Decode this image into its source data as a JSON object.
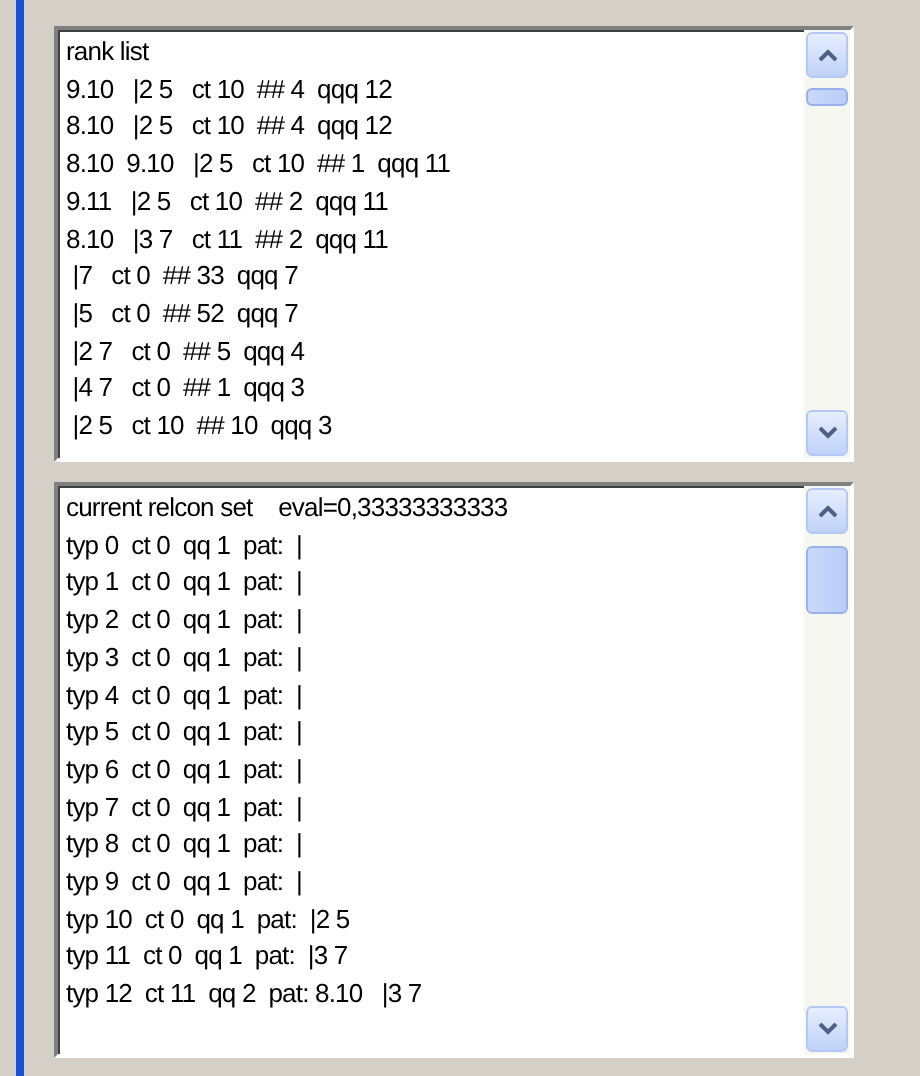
{
  "lists": [
    {
      "lines": [
        "rank list",
        "9.10   |2 5   ct 10  ## 4  qqq 12",
        "8.10   |2 5   ct 10  ## 4  qqq 12",
        "8.10  9.10   |2 5   ct 10  ## 1  qqq 11",
        "9.11   |2 5   ct 10  ## 2  qqq 11",
        "8.10   |3 7   ct 11  ## 2  qqq 11",
        " |7   ct 0  ## 33  qqq 7",
        " |5   ct 0  ## 52  qqq 7",
        " |2 7   ct 0  ## 5  qqq 4",
        " |4 7   ct 0  ## 1  qqq 3",
        " |2 5   ct 10  ## 10  qqq 3"
      ]
    },
    {
      "lines": [
        "current relcon set    eval=0,33333333333",
        "typ 0  ct 0  qq 1  pat:  |",
        "typ 1  ct 0  qq 1  pat:  |",
        "typ 2  ct 0  qq 1  pat:  |",
        "typ 3  ct 0  qq 1  pat:  |",
        "typ 4  ct 0  qq 1  pat:  |",
        "typ 5  ct 0  qq 1  pat:  |",
        "typ 6  ct 0  qq 1  pat:  |",
        "typ 7  ct 0  qq 1  pat:  |",
        "typ 8  ct 0  qq 1  pat:  |",
        "typ 9  ct 0  qq 1  pat:  |",
        "typ 10  ct 0  qq 1  pat:  |2 5",
        "typ 11  ct 0  qq 1  pat:  |3 7",
        "typ 12  ct 11  qq 2  pat: 8.10   |3 7"
      ]
    }
  ]
}
